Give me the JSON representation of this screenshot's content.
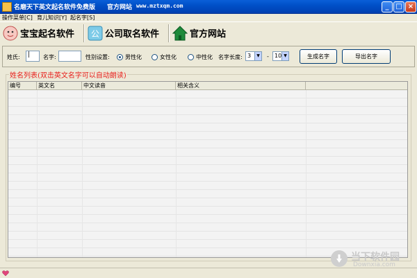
{
  "window": {
    "title": "名磨天下英文起名软件免费版",
    "site": "官方网站",
    "url": "www.mztxqm.com"
  },
  "menu": [
    "操作菜单[C]",
    "育儿知识[Y]",
    "起名字[S]"
  ],
  "toolbar": {
    "baby_naming": "宝宝起名软件",
    "company_naming": "公司取名软件",
    "official_site": "官方网站"
  },
  "form": {
    "surname_label": "姓氏:",
    "surname_value": "|",
    "given_name_label": "名字:",
    "given_name_value": "",
    "gender_label": "性别设置:",
    "gender_options": [
      "男性化",
      "女性化",
      "中性化"
    ],
    "gender_selected": "男性化",
    "length_label": "名字长度:",
    "length_min": "3",
    "length_dash": "-",
    "length_max": "10",
    "generate_button": "生成名字",
    "export_button": "导出名字"
  },
  "name_list": {
    "title": "姓名列表(双击英文名字可以自动朗读)",
    "columns": [
      "编号",
      "英文名",
      "中文读音",
      "相关含义"
    ],
    "rows": []
  },
  "watermark": {
    "text": "当下软件园",
    "sub": "Downxia.com"
  },
  "colors": {
    "titlebar": "#0050c8",
    "list_title": "#e8201c",
    "background": "#ece9d8"
  }
}
